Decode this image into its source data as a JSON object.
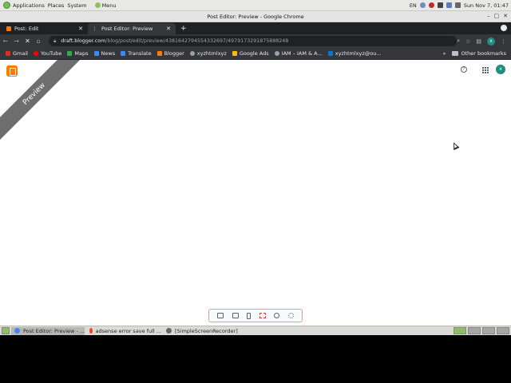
{
  "top_panel": {
    "applications": "Applications",
    "places": "Places",
    "system": "System",
    "menu": "Menu",
    "lang": "EN",
    "datetime": "Sun Nov 7, 01:47"
  },
  "window": {
    "title": "Post Editor: Preview - Google Chrome"
  },
  "tabs": [
    {
      "label": "Post: Edit"
    },
    {
      "label": "Post Editor: Preview"
    }
  ],
  "address_bar": {
    "host": "draft.blogger.com",
    "path": "/blog/post/edit/preview/4381642794554332697/4979173291875888248"
  },
  "bookmarks": [
    {
      "label": "Gmail",
      "color": "#d93025"
    },
    {
      "label": "YouTube",
      "color": "#ff0000"
    },
    {
      "label": "Maps",
      "color": "#34a853"
    },
    {
      "label": "News",
      "color": "#4285f4"
    },
    {
      "label": "Translate",
      "color": "#4285f4"
    },
    {
      "label": "Blogger",
      "color": "#f57d00"
    },
    {
      "label": "xyzhtmlxyz",
      "color": "#9aa0a6"
    },
    {
      "label": "Google Ads",
      "color": "#fbbc04"
    },
    {
      "label": "IAM – IAM & A...",
      "color": "#9aa0a6"
    },
    {
      "label": "xyzhtmlxyz@ou...",
      "color": "#0078d4"
    }
  ],
  "other_bookmarks": "Other bookmarks",
  "page": {
    "ribbon": "Preview",
    "avatar_letter": "x",
    "help_glyph": "?"
  },
  "taskbar": {
    "items": [
      {
        "label": "Post Editor: Preview - ..."
      },
      {
        "label": "adsense error save full ..."
      },
      {
        "label": "[SimpleScreenRecorder]"
      }
    ]
  }
}
